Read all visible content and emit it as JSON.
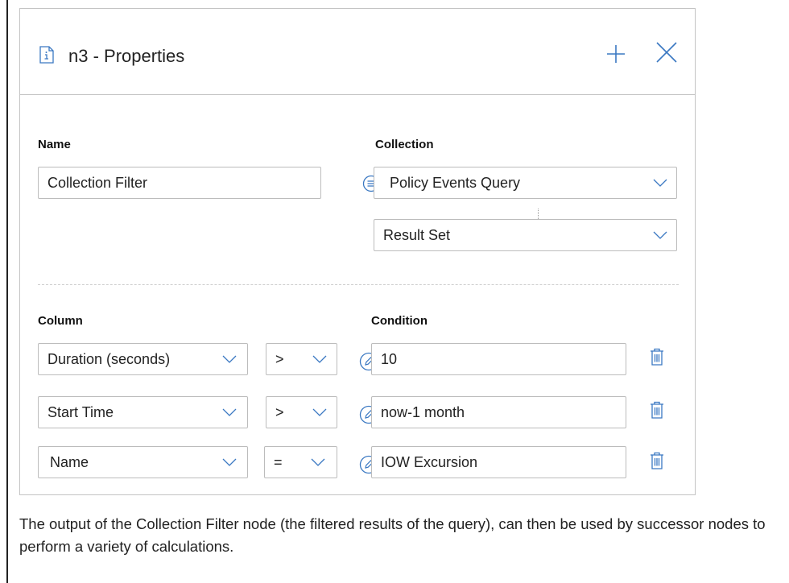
{
  "panel": {
    "title": "n3 - Properties",
    "header_icons": [
      "info-icon",
      "add-icon",
      "close-icon"
    ]
  },
  "name_section": {
    "label": "Name",
    "value": "Collection Filter"
  },
  "collection_section": {
    "label": "Collection",
    "collection_value": "Policy Events Query",
    "result_value": "Result Set"
  },
  "filters": {
    "column_label": "Column",
    "condition_label": "Condition",
    "rows": [
      {
        "column": "Duration (seconds)",
        "operator": ">",
        "condition": "10"
      },
      {
        "column": "Start Time",
        "operator": ">",
        "condition": "now-1 month"
      },
      {
        "column": "Name",
        "operator": "=",
        "condition": "IOW Excursion"
      }
    ]
  },
  "footer": {
    "text": "The output of the Collection Filter node (the filtered results of the query), can then be used by successor nodes to perform a variety of calculations."
  },
  "colors": {
    "accent": "#3a78c2",
    "border": "#bcbcbc",
    "divider": "#cfcfcf",
    "text": "#222222"
  }
}
